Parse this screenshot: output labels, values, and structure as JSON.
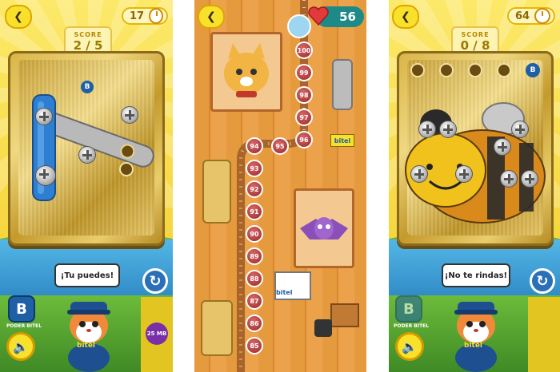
{
  "left_panel": {
    "back_icon": "chevron-left-icon",
    "level": "17",
    "score_label": "SCORE",
    "score": "2 / 5",
    "speech": "¡Tu puedes!",
    "logo_letter": "B",
    "logo_caption": "PODER BITEL",
    "mascot_brand": "bitel",
    "side_badge": "25 MB"
  },
  "middle_panel": {
    "back_icon": "chevron-left-icon",
    "lives": "56",
    "levels": [
      "100",
      "99",
      "98",
      "97",
      "96",
      "95",
      "94",
      "93",
      "92",
      "91",
      "90",
      "89",
      "88",
      "87",
      "86",
      "85"
    ],
    "sign_text": "bitel"
  },
  "right_panel": {
    "back_icon": "chevron-left-icon",
    "level": "64",
    "score_label": "SCORE",
    "score": "0 / 8",
    "speech": "¡No te rindas!",
    "logo_letter": "B",
    "logo_caption": "PODER BITEL",
    "mascot_brand": "bitel"
  },
  "colors": {
    "sky": "#fce96a",
    "board_gold": "#d9b548",
    "accent_blue": "#2b6fb8",
    "level_red": "#9b2626",
    "lives_teal": "#1e8a87"
  }
}
